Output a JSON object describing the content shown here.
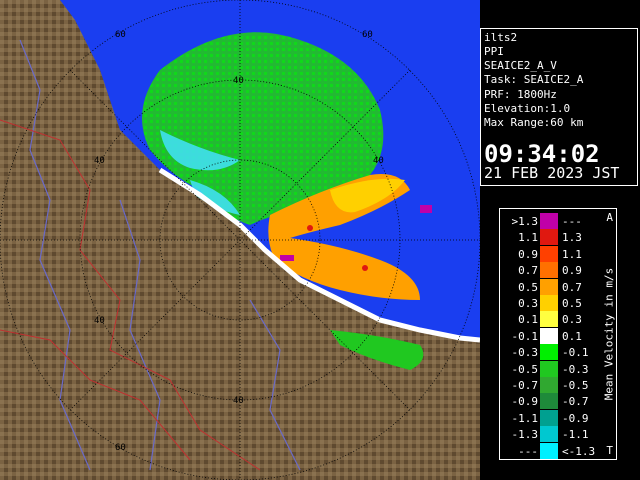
{
  "info": {
    "radar": "ilts2",
    "mode": "PPI",
    "product": "SEAICE2_A_V",
    "task": "Task: SEAICE2_A",
    "prf": "PRF: 1800Hz",
    "elevation": "Elevation:1.0",
    "max_range": "Max Range:60 km",
    "time": "09:34:02",
    "date": "21 FEB 2023 JST"
  },
  "legend": {
    "title": "Mean Velocity in m/s",
    "corner_top": "A",
    "corner_bottom": "T",
    "rows": [
      {
        "lo": ">1.3",
        "hi": "---",
        "color": "#c000a8"
      },
      {
        "lo": "1.1",
        "hi": "1.3",
        "color": "#e01810"
      },
      {
        "lo": "0.9",
        "hi": "1.1",
        "color": "#ff4000"
      },
      {
        "lo": "0.7",
        "hi": "0.9",
        "color": "#ff7000"
      },
      {
        "lo": "0.5",
        "hi": "0.7",
        "color": "#ffa000"
      },
      {
        "lo": "0.3",
        "hi": "0.5",
        "color": "#ffd000"
      },
      {
        "lo": "0.1",
        "hi": "0.3",
        "color": "#ffff40"
      },
      {
        "lo": "-0.1",
        "hi": "0.1",
        "color": "#ffffff"
      },
      {
        "lo": "-0.3",
        "hi": "-0.1",
        "color": "#00f000"
      },
      {
        "lo": "-0.5",
        "hi": "-0.3",
        "color": "#20c820"
      },
      {
        "lo": "-0.7",
        "hi": "-0.5",
        "color": "#30a830"
      },
      {
        "lo": "-0.9",
        "hi": "-0.7",
        "color": "#1e8a3a"
      },
      {
        "lo": "-1.1",
        "hi": "-0.9",
        "color": "#00a090"
      },
      {
        "lo": "-1.3",
        "hi": "-1.1",
        "color": "#00c8d0"
      },
      {
        "lo": "---",
        "hi": "<-1.3",
        "color": "#00f0ff"
      }
    ]
  },
  "map": {
    "range_ring_labels": [
      "60",
      "40",
      "40",
      "40",
      "40",
      "60",
      "40",
      "60"
    ],
    "colors": {
      "sea": "#1a3ef0",
      "land": "#7b6343",
      "ring": "#000000"
    }
  }
}
